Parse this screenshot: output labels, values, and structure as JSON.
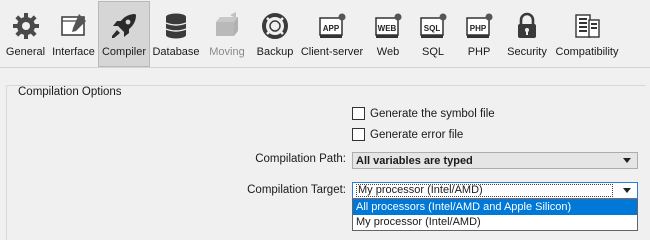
{
  "toolbar": {
    "items": [
      {
        "label": "General",
        "icon": "gear-icon"
      },
      {
        "label": "Interface",
        "icon": "interface-icon"
      },
      {
        "label": "Compiler",
        "icon": "rocket-icon"
      },
      {
        "label": "Database",
        "icon": "database-icon"
      },
      {
        "label": "Moving",
        "icon": "box-icon"
      },
      {
        "label": "Backup",
        "icon": "lifebuoy-icon"
      },
      {
        "label": "Client-server",
        "icon": "app-icon"
      },
      {
        "label": "Web",
        "icon": "web-icon"
      },
      {
        "label": "SQL",
        "icon": "sql-icon"
      },
      {
        "label": "PHP",
        "icon": "php-icon"
      },
      {
        "label": "Security",
        "icon": "lock-icon"
      },
      {
        "label": "Compatibility",
        "icon": "compatibility-icon"
      }
    ],
    "active": "Compiler",
    "disabled": [
      "Moving"
    ]
  },
  "compilation": {
    "group_title": "Compilation Options",
    "symbol_file_label": "Generate the symbol file",
    "symbol_file_checked": false,
    "error_file_label": "Generate error file",
    "error_file_checked": false,
    "path_label": "Compilation Path:",
    "path_value": "All variables are typed",
    "target_label": "Compilation Target:",
    "target_value": "My processor (Intel/AMD)",
    "target_options": [
      "All processors (Intel/AMD and Apple Silicon)",
      "My processor (Intel/AMD)"
    ],
    "target_highlighted": "All processors (Intel/AMD and Apple Silicon)"
  },
  "colors": {
    "highlight": "#0078d7",
    "toolbar_active_bg": "#d6d6d6"
  }
}
